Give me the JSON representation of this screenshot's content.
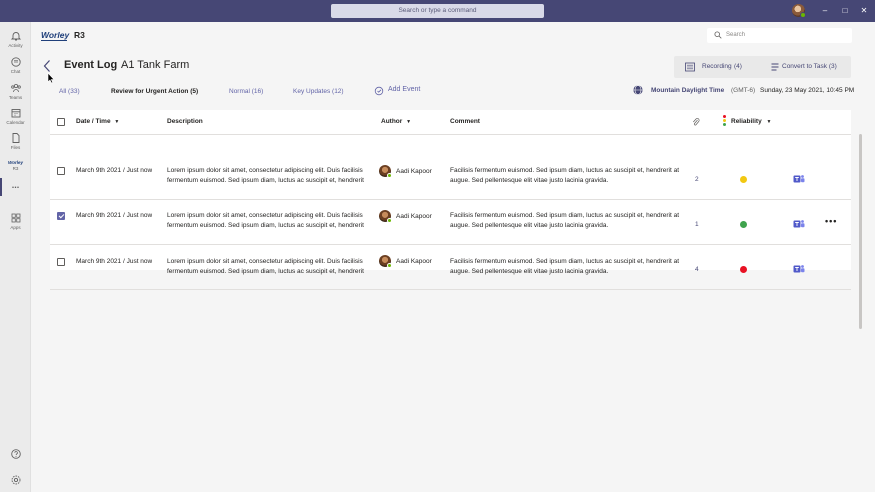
{
  "titlebar": {
    "search_placeholder": "Search or type a command",
    "minimize": "–",
    "maximize": "□",
    "close": "✕"
  },
  "rail": {
    "items": [
      {
        "label": "Activity",
        "icon": "bell-icon"
      },
      {
        "label": "Chat",
        "icon": "chat-icon"
      },
      {
        "label": "Teams",
        "icon": "teams-icon"
      },
      {
        "label": "Calendar",
        "icon": "calendar-icon"
      },
      {
        "label": "Files",
        "icon": "files-icon"
      },
      {
        "label": "Worley",
        "sublabel": "R3",
        "icon": "worley-logo"
      },
      {
        "label": "...",
        "icon": "more-icon"
      },
      {
        "label": "Apps",
        "icon": "apps-icon"
      }
    ],
    "help_icon": "help-icon",
    "settings_icon": "settings-icon"
  },
  "header": {
    "brand": "Worley",
    "app_name": "R3",
    "search_placeholder": "Search"
  },
  "page": {
    "title": "Event Log",
    "subtitle": "A1 Tank Farm"
  },
  "actions": {
    "recording_label": "Recording",
    "recording_count": "(4)",
    "convert_label": "Convert to Task (3)"
  },
  "tabs": [
    {
      "label": "All",
      "count": "(33)"
    },
    {
      "label": "Review for Urgent Action (5)",
      "count": ""
    },
    {
      "label": "Normal",
      "count": "(16)"
    },
    {
      "label": "Key Updates",
      "count": "(12)"
    }
  ],
  "add_event_label": "Add Event",
  "timezone": {
    "name": "Mountain Daylight Time",
    "offset": "(GMT-6)",
    "datetime": "Sunday, 23 May 2021, 10:45 PM"
  },
  "table": {
    "columns": {
      "date": "Date / Time",
      "description": "Description",
      "author": "Author",
      "comment": "Comment",
      "reliability": "Reliability"
    },
    "rows": [
      {
        "checked": false,
        "date": "March 9th 2021 / Just now",
        "desc_line1": "Lorem ipsum dolor sit amet, consectetur adipiscing elit. Duis facilisis",
        "desc_line2": "fermentum euismod. Sed ipsum diam, luctus ac suscipit et, hendrerit",
        "author": "Aadi Kapoor",
        "comment_line1": "Facilisis fermentum euismod. Sed ipsum diam, luctus ac suscipit et, hendrerit at",
        "comment_line2": "augue. Sed pellentesque elit vitae justo lacinia gravida.",
        "attachments": "2",
        "reliability_color": "#f2c811"
      },
      {
        "checked": true,
        "date": "March 9th 2021 / Just now",
        "desc_line1": "Lorem ipsum dolor sit amet, consectetur adipiscing elit. Duis facilisis",
        "desc_line2": "fermentum euismod. Sed ipsum diam, luctus ac suscipit et, hendrerit",
        "author": "Aadi Kapoor",
        "comment_line1": "Facilisis fermentum euismod. Sed ipsum diam, luctus ac suscipit et, hendrerit at",
        "comment_line2": "augue. Sed pellentesque elit vitae justo lacinia gravida.",
        "attachments": "1",
        "reliability_color": "#3fa34d",
        "more": "•••"
      },
      {
        "checked": false,
        "date": "March 9th 2021 / Just now",
        "desc_line1": "Lorem ipsum dolor sit amet, consectetur adipiscing elit. Duis facilisis",
        "desc_line2": "fermentum euismod. Sed ipsum diam, luctus ac suscipit et, hendrerit",
        "author": "Aadi Kapoor",
        "comment_line1": "Facilisis fermentum euismod. Sed ipsum diam, luctus ac suscipit et, hendrerit at",
        "comment_line2": "augue. Sed pellentesque elit vitae justo lacinia gravida.",
        "attachments": "4",
        "reliability_color": "#e81123"
      }
    ]
  },
  "colors": {
    "titlebar": "#464775",
    "accent": "#6264a7",
    "brand": "#1f3f7a"
  }
}
